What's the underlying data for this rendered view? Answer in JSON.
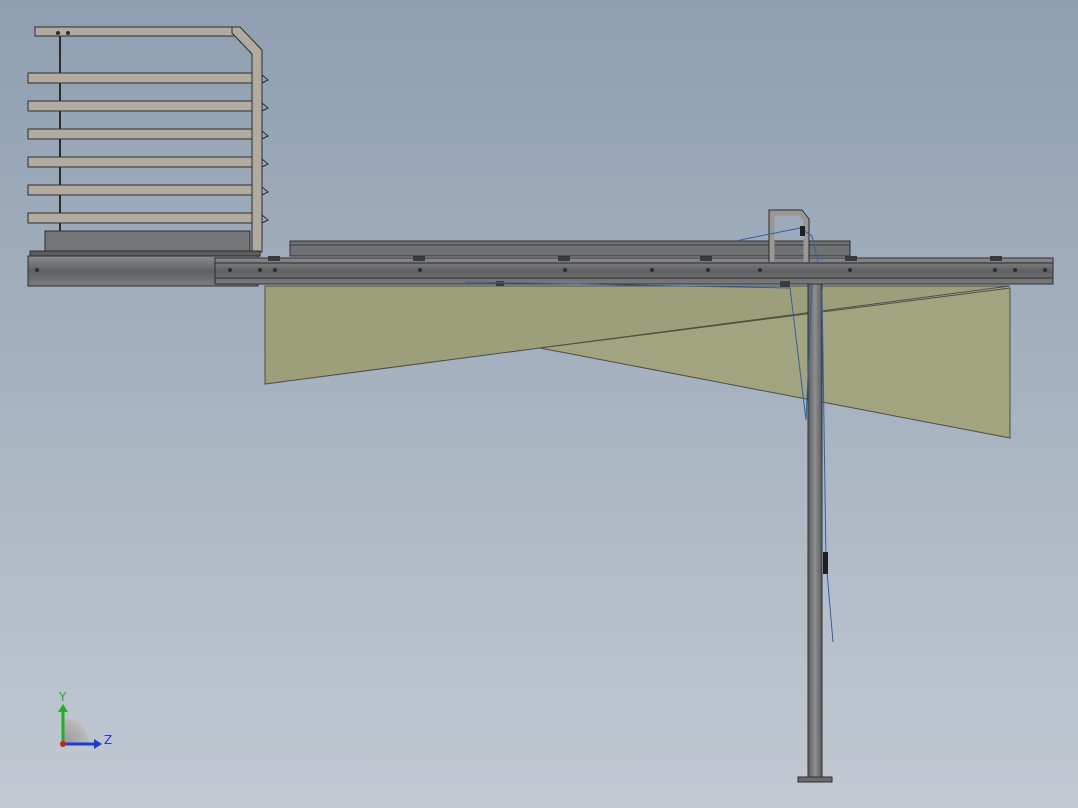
{
  "view": {
    "background_top": "#8f9fb1",
    "background_bottom": "#c2c9d3",
    "model_icon": "cad-assembly-side-view"
  },
  "colors": {
    "steel": "#6e6f70",
    "steel_dark": "#3c3d3f",
    "steel_light": "#8c8d8e",
    "rail_tan": "#b3aba0",
    "sail": "#9d9f7b",
    "wire": "#2f5fa8",
    "axis_y": "#22b022",
    "axis_z": "#1e3ec8",
    "axis_x": "#d02020"
  },
  "triad": {
    "y_label": "Y",
    "z_label": "Z",
    "icon": "coordinate-triad-icon"
  }
}
